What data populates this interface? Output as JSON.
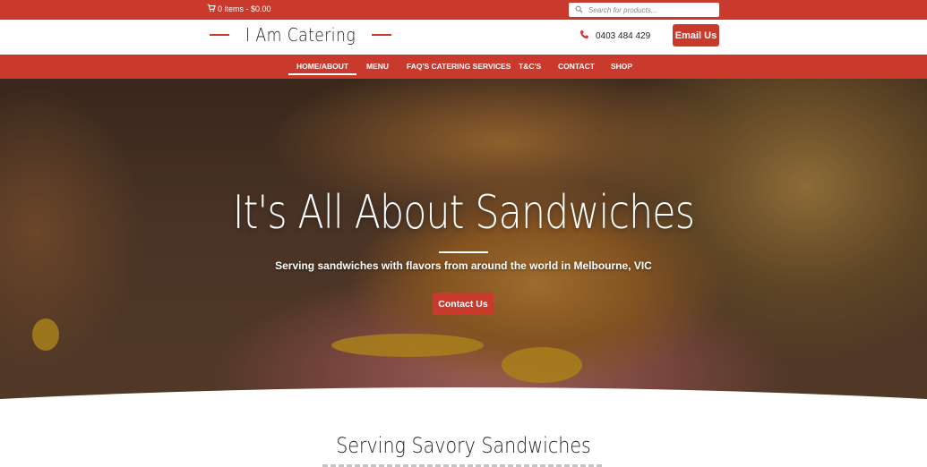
{
  "topbar": {
    "cart_text": "0 items - $0.00",
    "search_placeholder": "Search for products..."
  },
  "header": {
    "logo": "I Am Catering",
    "phone": "0403 484 429",
    "email_button": "Email Us"
  },
  "nav": {
    "items": [
      {
        "label": "HOME/ABOUT",
        "active": true
      },
      {
        "label": "MENU"
      },
      {
        "label": "FAQ'S CATERING SERVICES"
      },
      {
        "label": "T&C'S"
      },
      {
        "label": "CONTACT"
      },
      {
        "label": "SHOP"
      }
    ]
  },
  "hero": {
    "title": "It's All About Sandwiches",
    "subtitle": "Serving sandwiches with flavors from around the world in Melbourne, VIC",
    "button": "Contact Us"
  },
  "section": {
    "title": "Serving Savory Sandwiches"
  },
  "colors": {
    "brand_red": "#c9392c",
    "white": "#ffffff"
  },
  "icons": [
    "cart-icon",
    "search-icon",
    "phone-icon"
  ]
}
